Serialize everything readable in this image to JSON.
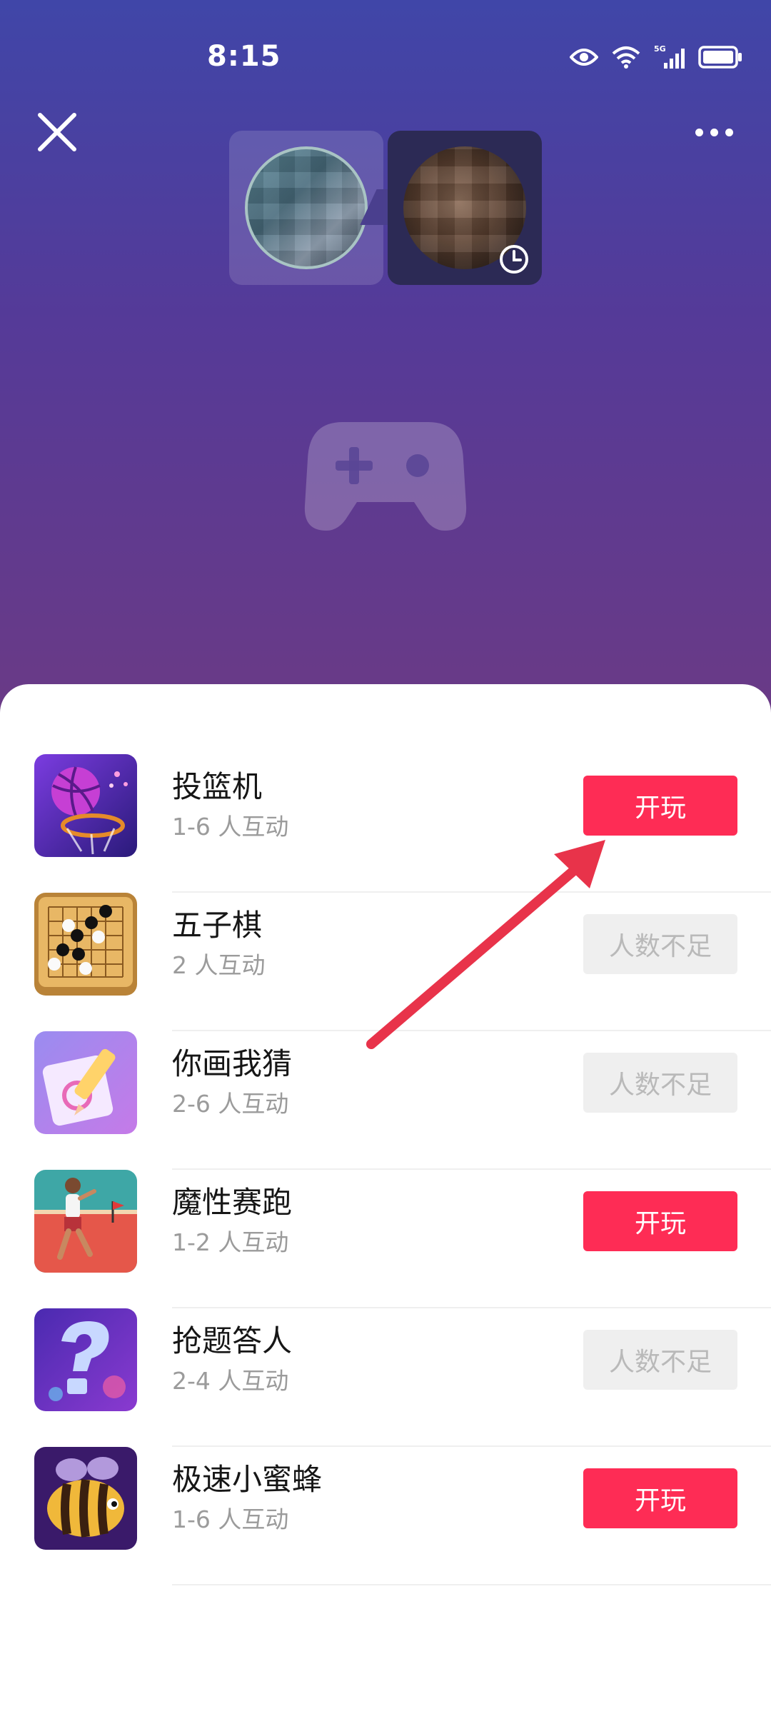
{
  "status_bar": {
    "time": "8:15",
    "network": "5G"
  },
  "header": {
    "icons": [
      "close-icon",
      "more-icon"
    ]
  },
  "games": [
    {
      "name": "投篮机",
      "players": "1-6 人互动",
      "button": "开玩",
      "state": "play",
      "icon": "basketball-icon"
    },
    {
      "name": "五子棋",
      "players": "2 人互动",
      "button": "人数不足",
      "state": "insufficient",
      "icon": "gomoku-board-icon"
    },
    {
      "name": "你画我猜",
      "players": "2-6 人互动",
      "button": "人数不足",
      "state": "insufficient",
      "icon": "pencil-drawing-icon"
    },
    {
      "name": "魔性赛跑",
      "players": "1-2 人互动",
      "button": "开玩",
      "state": "play",
      "icon": "runner-icon"
    },
    {
      "name": "抢题答人",
      "players": "2-4 人互动",
      "button": "人数不足",
      "state": "insufficient",
      "icon": "question-mark-icon"
    },
    {
      "name": "极速小蜜蜂",
      "players": "1-6 人互动",
      "button": "开玩",
      "state": "play",
      "icon": "bee-icon"
    }
  ],
  "colors": {
    "accent": "#fe2c55",
    "disabled_bg": "#efefef",
    "disabled_text": "#b9b9b9",
    "annotation_arrow": "#e8334a"
  }
}
